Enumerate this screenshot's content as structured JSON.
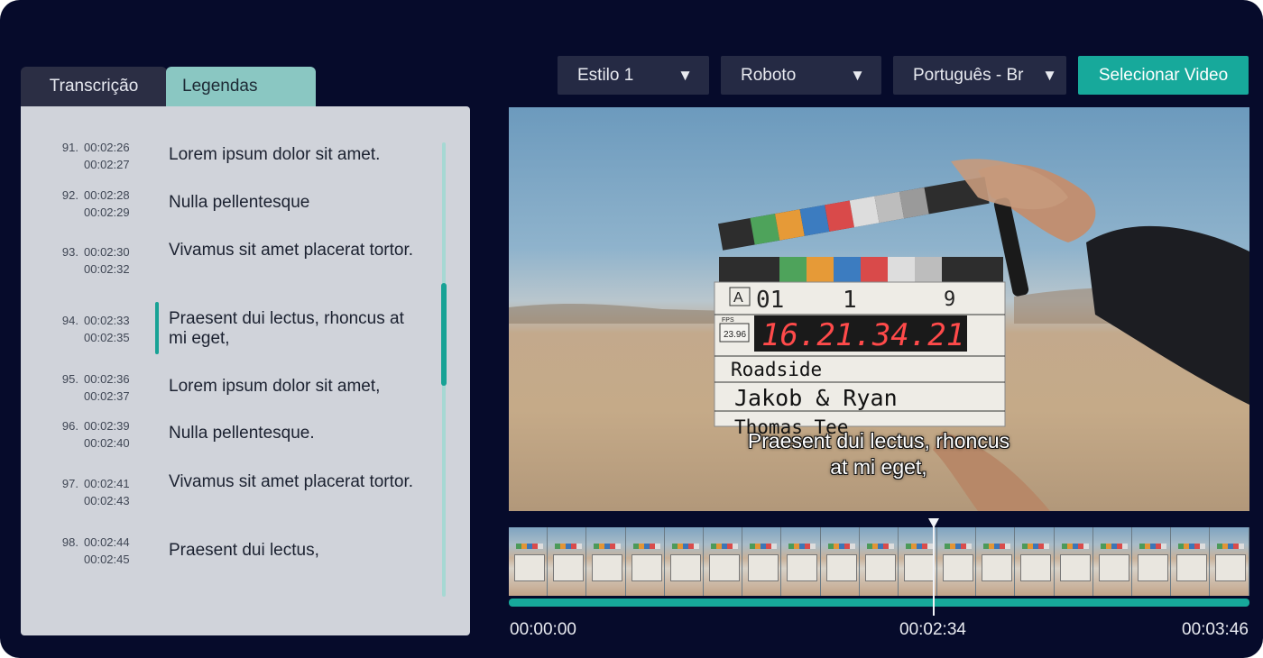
{
  "tabs": [
    {
      "label": "Transcrição"
    },
    {
      "label": "Legendas"
    }
  ],
  "toolbar": {
    "style": "Estilo 1",
    "font": "Roboto",
    "language": "Português - Br",
    "select_video": "Selecionar Video"
  },
  "subtitles": [
    {
      "index": "91.",
      "start": "00:02:26",
      "end": "00:02:27",
      "text": "Lorem ipsum dolor sit amet."
    },
    {
      "index": "92.",
      "start": "00:02:28",
      "end": "00:02:29",
      "text": "Nulla pellentesque"
    },
    {
      "index": "93.",
      "start": "00:02:30",
      "end": "00:02:32",
      "text": "Vivamus sit amet placerat tortor."
    },
    {
      "index": "94.",
      "start": "00:02:33",
      "end": "00:02:35",
      "text": "Praesent dui lectus, rhoncus at mi eget,"
    },
    {
      "index": "95.",
      "start": "00:02:36",
      "end": "00:02:37",
      "text": "Lorem ipsum dolor sit amet,"
    },
    {
      "index": "96.",
      "start": "00:02:39",
      "end": "00:02:40",
      "text": "Nulla pellentesque."
    },
    {
      "index": "97.",
      "start": "00:02:41",
      "end": "00:02:43",
      "text": "Vivamus sit amet placerat tortor."
    },
    {
      "index": "98.",
      "start": "00:02:44",
      "end": "00:02:45",
      "text": "Praesent dui lectus,"
    }
  ],
  "active_subtitle": "94.",
  "video": {
    "caption_line1": "Praesent dui lectus, rhoncus",
    "caption_line2": "at mi eget,",
    "clapper": {
      "scene_a": "A",
      "scene_num": "01",
      "take": "1",
      "roll": "9",
      "fps": "23.96",
      "fps_label": "FPS",
      "timecode": "16.21.34.21",
      "prod": "Roadside",
      "director": "Jakob & Ryan",
      "cam": "Thomas Tee"
    }
  },
  "timeline": {
    "start": "00:00:00",
    "current": "00:02:34",
    "end": "00:03:46",
    "progress_fraction": 0.57
  },
  "colors": {
    "background": "#060b2b",
    "accent": "#17a99b",
    "tab_active": "#8ac7c2",
    "panel": "#d0d3da"
  }
}
